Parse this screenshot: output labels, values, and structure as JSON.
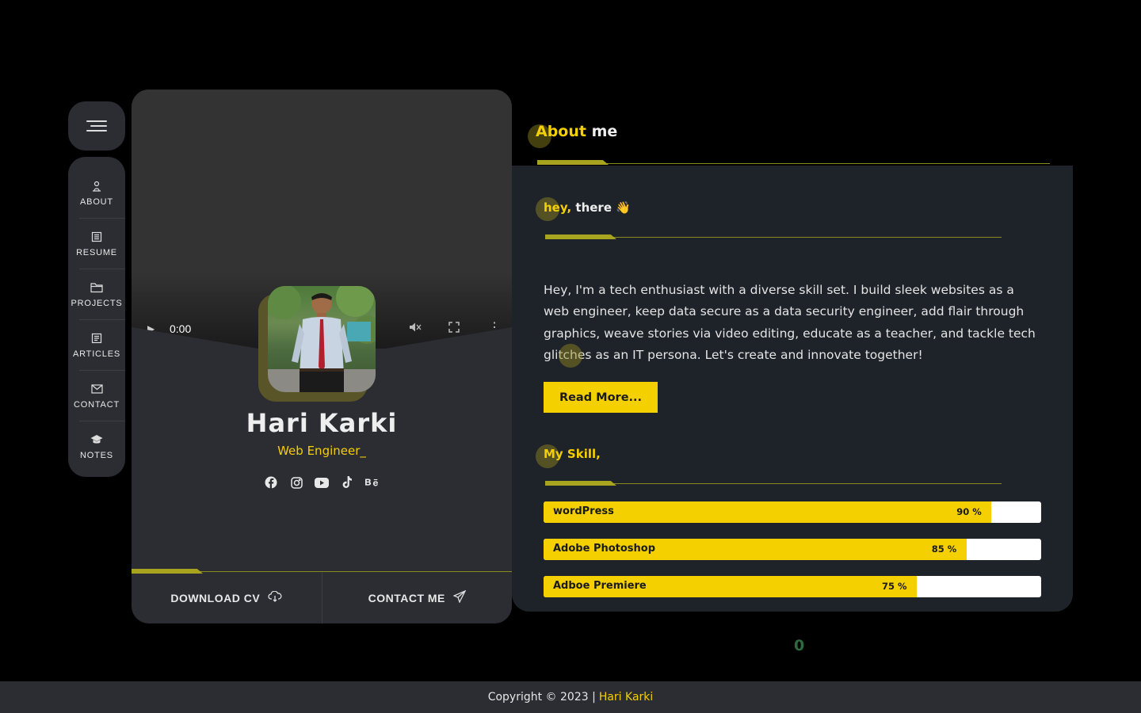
{
  "sidebar": {
    "items": [
      {
        "label": "ABOUT",
        "icon": "user-icon"
      },
      {
        "label": "RESUME",
        "icon": "resume-icon"
      },
      {
        "label": "PROJECTS",
        "icon": "folder-icon"
      },
      {
        "label": "ARTICLES",
        "icon": "article-icon"
      },
      {
        "label": "CONTACT",
        "icon": "mail-icon"
      },
      {
        "label": "NOTES",
        "icon": "graduation-cap-icon"
      }
    ]
  },
  "profile": {
    "video_time": "0:00",
    "name": "Hari Karki",
    "role": "Web Engineer_",
    "socials": [
      "facebook-icon",
      "instagram-icon",
      "youtube-icon",
      "tiktok-icon",
      "behance-icon"
    ],
    "download_label": "DOWNLOAD CV",
    "contact_label": "CONTACT ME"
  },
  "about": {
    "title_highlight": "About",
    "title_rest": " me",
    "greeting_highlight": "hey,",
    "greeting_rest": " there 👋",
    "bio": "Hey, I'm a tech enthusiast with a diverse skill set. I build sleek websites as a web engineer, keep data secure as a data security engineer, add flair through graphics, weave stories via video editing, educate as a teacher, and tackle tech glitches as an IT persona. Let's create and innovate together!",
    "read_more_label": "Read More...",
    "skills_title": "My Skill,",
    "skills": [
      {
        "name": "wordPress",
        "percent": 90,
        "label": "90 %"
      },
      {
        "name": "Adobe Photoshop",
        "percent": 85,
        "label": "85 %"
      },
      {
        "name": "Adboe Premiere",
        "percent": 75,
        "label": "75 %"
      }
    ]
  },
  "counter": "0",
  "footer": {
    "text": "Copyright © 2023 |",
    "author": "Hari Karki"
  },
  "colors": {
    "accent": "#f5d000",
    "background": "#000000",
    "card": "#2c2d33",
    "panel": "#1e232a"
  }
}
